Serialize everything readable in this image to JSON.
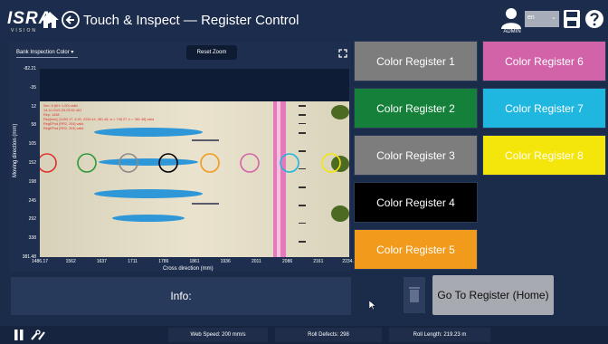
{
  "header": {
    "logo": "ISRA",
    "logo_sub": "VISION",
    "title": "Touch & Inspect — Register Control",
    "user_label": "ADMIN",
    "language": "en"
  },
  "viewer": {
    "bank_select": "Bank Inspection Color",
    "reset_zoom": "Reset Zoom",
    "y_axis_label": "Moving direction (mm)",
    "x_axis_label": "Cross direction (mm)",
    "y_ticks": [
      "-82.21",
      "-35",
      "12",
      "58",
      "105",
      "152",
      "198",
      "245",
      "292",
      "338",
      "381.48"
    ],
    "x_ticks": [
      "1486.17",
      "1562",
      "1637",
      "1711",
      "1786",
      "1861",
      "1936",
      "2011",
      "2086",
      "2161",
      "2234.4"
    ],
    "overlay_text": [
      "Scn: 8 (6H: 1.00) valid",
      "14.10.2021,09:25:52.461",
      "Rep: 1438",
      "Rep[mm]: [1490.17, 6.00, 2234.44, 381.48, w = 748.27, h = 381.48] valid",
      "RegEPod [RR2, 204] valid",
      "RegEPod [RR2, 209] valid"
    ]
  },
  "registers": [
    {
      "label": "Color Register 1",
      "bg": "#7d7d7d",
      "fg": "#ffffff"
    },
    {
      "label": "Color Register 2",
      "bg": "#14803a",
      "fg": "#ffffff"
    },
    {
      "label": "Color Register 3",
      "bg": "#7d7d7d",
      "fg": "#ffffff"
    },
    {
      "label": "Color Register 4",
      "bg": "#000000",
      "fg": "#ffffff"
    },
    {
      "label": "Color Register 5",
      "bg": "#f29a1c",
      "fg": "#ffffff"
    },
    {
      "label": "Color Register 6",
      "bg": "#d363a8",
      "fg": "#ffffff"
    },
    {
      "label": "Color Register 7",
      "bg": "#1fb6df",
      "fg": "#ffffff"
    },
    {
      "label": "Color Register 8",
      "bg": "#f4e50a",
      "fg": "#ffffff"
    }
  ],
  "marks": [
    {
      "color": "#e03030"
    },
    {
      "color": "#2a9a3a"
    },
    {
      "color": "#8a8a8a"
    },
    {
      "color": "#000000"
    },
    {
      "color": "#f29a1c"
    },
    {
      "color": "#d363a8"
    },
    {
      "color": "#1fb6df"
    },
    {
      "color": "#f4e50a"
    }
  ],
  "info_label": "Info:",
  "go_register": "Go To Register (Home)",
  "status": {
    "web_speed": "Web Speed: 200 mm/s",
    "roll_defects": "Roll Defects: 298",
    "roll_length": "Roll Length: 219.23 m"
  }
}
